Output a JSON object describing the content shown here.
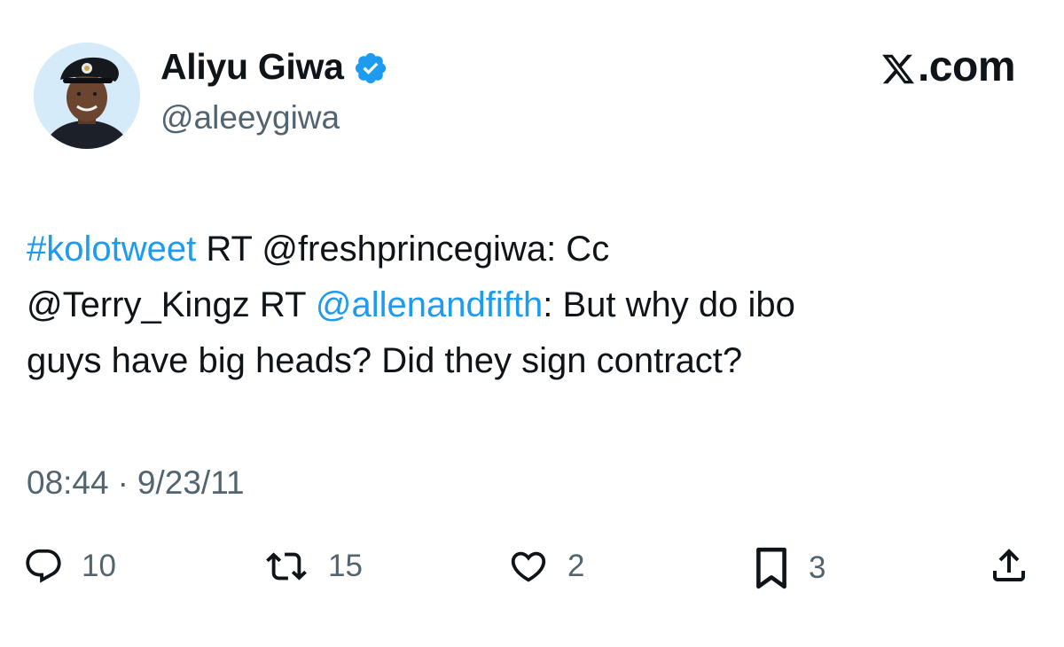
{
  "author": {
    "display_name": "Aliyu Giwa",
    "handle": "@aleeygiwa",
    "verified": true,
    "avatar_icon": "profile-photo"
  },
  "brand": {
    "label": ".com",
    "logo_icon": "x-logo-icon"
  },
  "tweet": {
    "segments": {
      "hashtag": "#kolotweet",
      "text1": " RT @freshprincegiwa: Cc",
      "text2": "@Terry_Kingz RT ",
      "mention": "@allenandfifth",
      "text3": ": But why do ibo",
      "text4": "guys have big heads? Did they sign contract?"
    },
    "time": "08:44",
    "separator": "·",
    "date": "9/23/11"
  },
  "actions": {
    "reply_count": "10",
    "retweet_count": "15",
    "like_count": "2",
    "bookmark_count": "3"
  },
  "colors": {
    "link": "#1d9bf0",
    "verified_badge": "#1d9bf0",
    "secondary_text": "#536471",
    "primary_text": "#0f1419"
  }
}
